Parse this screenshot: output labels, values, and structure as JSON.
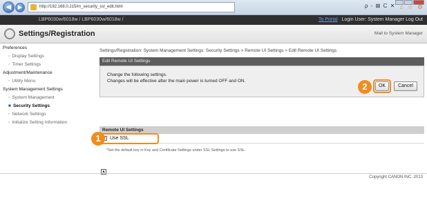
{
  "browser": {
    "address": "http://192.168.0.215/m_security_ssl_edit.html",
    "back_icon": "arrow-left-icon",
    "search_controls": "ρ - ⊠ C ✕",
    "toolbar_icons": [
      "home-icon",
      "star-icon",
      "gear-icon"
    ]
  },
  "header": {
    "model": "LBP6030w/6018w / LBP6030w/6018w /",
    "portal_link": "To Portal",
    "login_user": "Login User: System Manager",
    "logout": "Log Out"
  },
  "title_bar": {
    "title": "Settings/Registration",
    "mail_link": "Mail to System Manager"
  },
  "sidebar": {
    "groups": [
      {
        "label": "Preferences",
        "items": [
          {
            "label": "Display Settings"
          },
          {
            "label": "Timer Settings"
          }
        ]
      },
      {
        "label": "Adjustment/Maintenance",
        "items": [
          {
            "label": "Utility Menu"
          }
        ]
      },
      {
        "label": "System Management Settings",
        "items": [
          {
            "label": "System Management"
          },
          {
            "label": "Security Settings",
            "active": true
          },
          {
            "label": "Network Settings"
          },
          {
            "label": "Initialize Setting Information"
          }
        ]
      }
    ]
  },
  "main": {
    "breadcrumb": "Settings/Registration: System Management Settings: Security Settings > Remote UI Settings > Edit Remote UI Settings",
    "edit_header": "Edit Remote UI Settings",
    "message_line1": "Change the following settings.",
    "message_line2": "Changes will be effective after the main power is turned OFF and ON.",
    "ok_label": "OK",
    "cancel_label": "Cancel",
    "settings_header": "Remote UI Settings",
    "use_ssl_label": "Use SSL",
    "use_ssl_checked": true,
    "note": "*Set the default key in Key and Certificate Settings under SSL Settings to use SSL.",
    "callout_1": "1",
    "callout_2": "2",
    "callout_color": "#f08c1e"
  },
  "footer": {
    "copyright": "Copyright CANON INC. 2013"
  }
}
